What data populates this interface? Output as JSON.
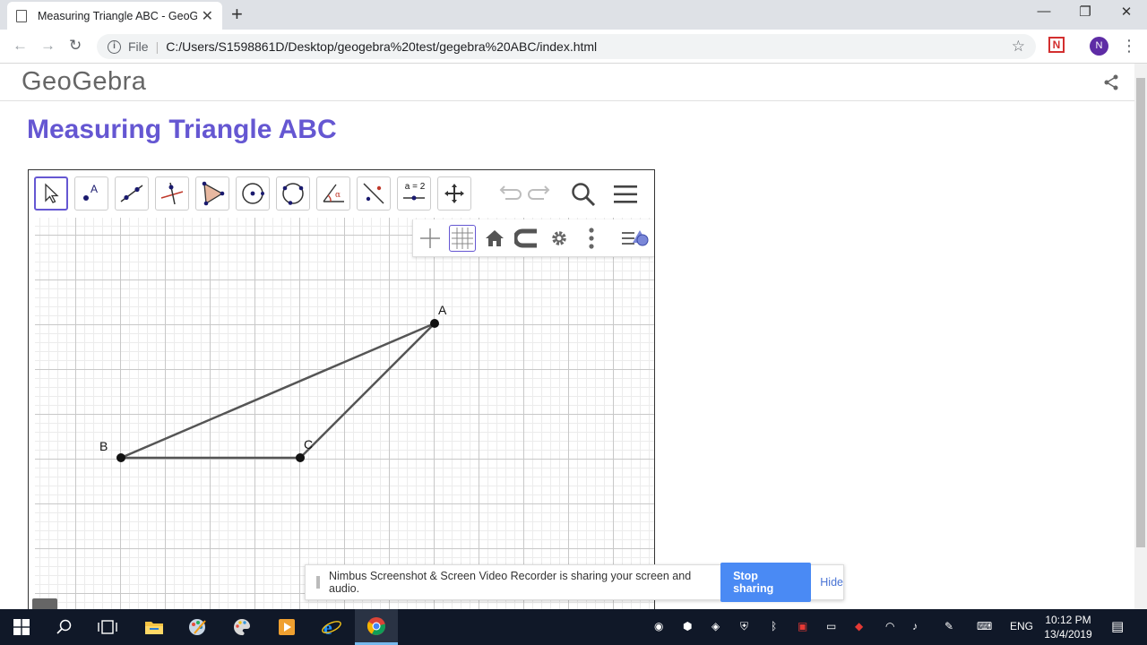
{
  "browser": {
    "tab_title": "Measuring Triangle ABC - GeoGebra",
    "new_tab": "+",
    "close_tab": "✕",
    "window_controls": {
      "minimize": "—",
      "restore": "❐",
      "close": "✕"
    },
    "url_scheme": "File",
    "url_separator": "|",
    "url": "C:/Users/S1598861D/Desktop/geogebra%20test/gegebra%20ABC/index.html",
    "profile_initial": "N",
    "extension_label": "N"
  },
  "page": {
    "logo": "GeoGebra",
    "title": "Measuring Triangle ABC"
  },
  "applet": {
    "tools": [
      "move-tool",
      "point-tool",
      "line-tool",
      "perpendicular-line-tool",
      "polygon-tool",
      "circle-center-tool",
      "circle-three-points-tool",
      "angle-tool",
      "reflect-tool",
      "slider-tool",
      "move-graphics-view-tool"
    ],
    "slider_tool_label": "a = 2",
    "points": [
      {
        "label": "A",
        "x": 7,
        "y": 3
      },
      {
        "label": "B",
        "x": 0,
        "y": 0
      },
      {
        "label": "C",
        "x": 4,
        "y": 0
      }
    ]
  },
  "notification": {
    "message": "Nimbus Screenshot & Screen Video Recorder is sharing your screen and audio.",
    "stop_label": "Stop sharing",
    "hide_label": "Hide"
  },
  "taskbar": {
    "language": "ENG",
    "time": "10:12 PM",
    "date": "13/4/2019"
  }
}
